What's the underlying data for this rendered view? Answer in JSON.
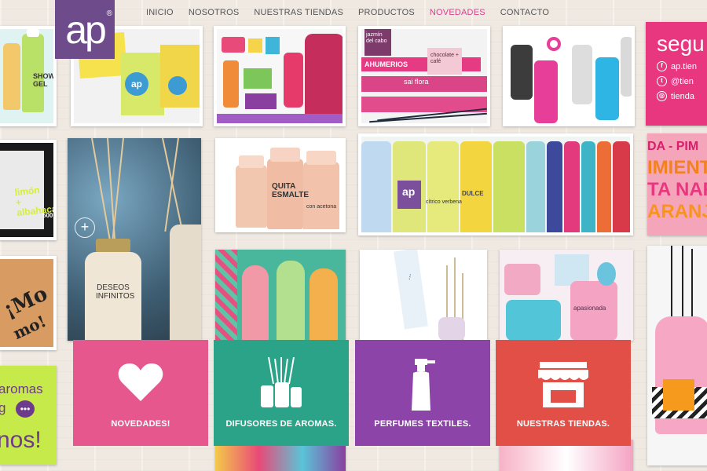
{
  "brand": {
    "logo_text": "ap",
    "logo_mark": "®"
  },
  "nav": {
    "items": [
      {
        "label": "INICIO"
      },
      {
        "label": "NOSOTROS"
      },
      {
        "label": "NUESTRAS TIENDAS"
      },
      {
        "label": "PRODUCTOS"
      },
      {
        "label": "NOVEDADES",
        "active": true
      },
      {
        "label": "CONTACTO"
      }
    ]
  },
  "tiles": {
    "shower_gel": "SHOW GEL",
    "tile_ap": "ap",
    "humerios": "AHUMERIOS",
    "jazmin": "jazmín del cabo",
    "chocolate": "chocolate + café",
    "sai_flora": "sai flora",
    "limon": "limón + albahaca",
    "limon_price": "500",
    "deseos": "DESEOS INFINITOS",
    "quita_esmalte": "QUITA ESMALTE",
    "quita_esmalte_sub": "con acetona",
    "citric": "cítrico verbena",
    "dulce": "DULCE",
    "mo": "¡Mo",
    "mo2": "mo!",
    "pimienta_lines": [
      "DA - PIM",
      "IMIENTA",
      "TA NAR",
      "ARANJA"
    ],
    "pasionata": "apasionada",
    "segui": "segu",
    "social": [
      "ap.tien",
      "@tien",
      "tienda"
    ],
    "aromas_lines": [
      "aromas",
      "g",
      "nos!"
    ],
    "ap_tag": "ap"
  },
  "cta": [
    {
      "label": "NOVEDADES!",
      "color": "#e6578e",
      "icon": "heart-icon"
    },
    {
      "label": "DIFUSORES DE AROMAS.",
      "color": "#2aa389",
      "icon": "diffuser-icon"
    },
    {
      "label": "PERFUMES TEXTILES.",
      "color": "#8c44a8",
      "icon": "spray-bottle-icon"
    },
    {
      "label": "NUESTRAS TIENDAS.",
      "color": "#e14f47",
      "icon": "store-icon"
    }
  ],
  "colors": {
    "accent_pink": "#d9418f",
    "logo_purple": "#6e4c8c",
    "lime": "#c6ea49",
    "magenta": "#e8367f"
  }
}
